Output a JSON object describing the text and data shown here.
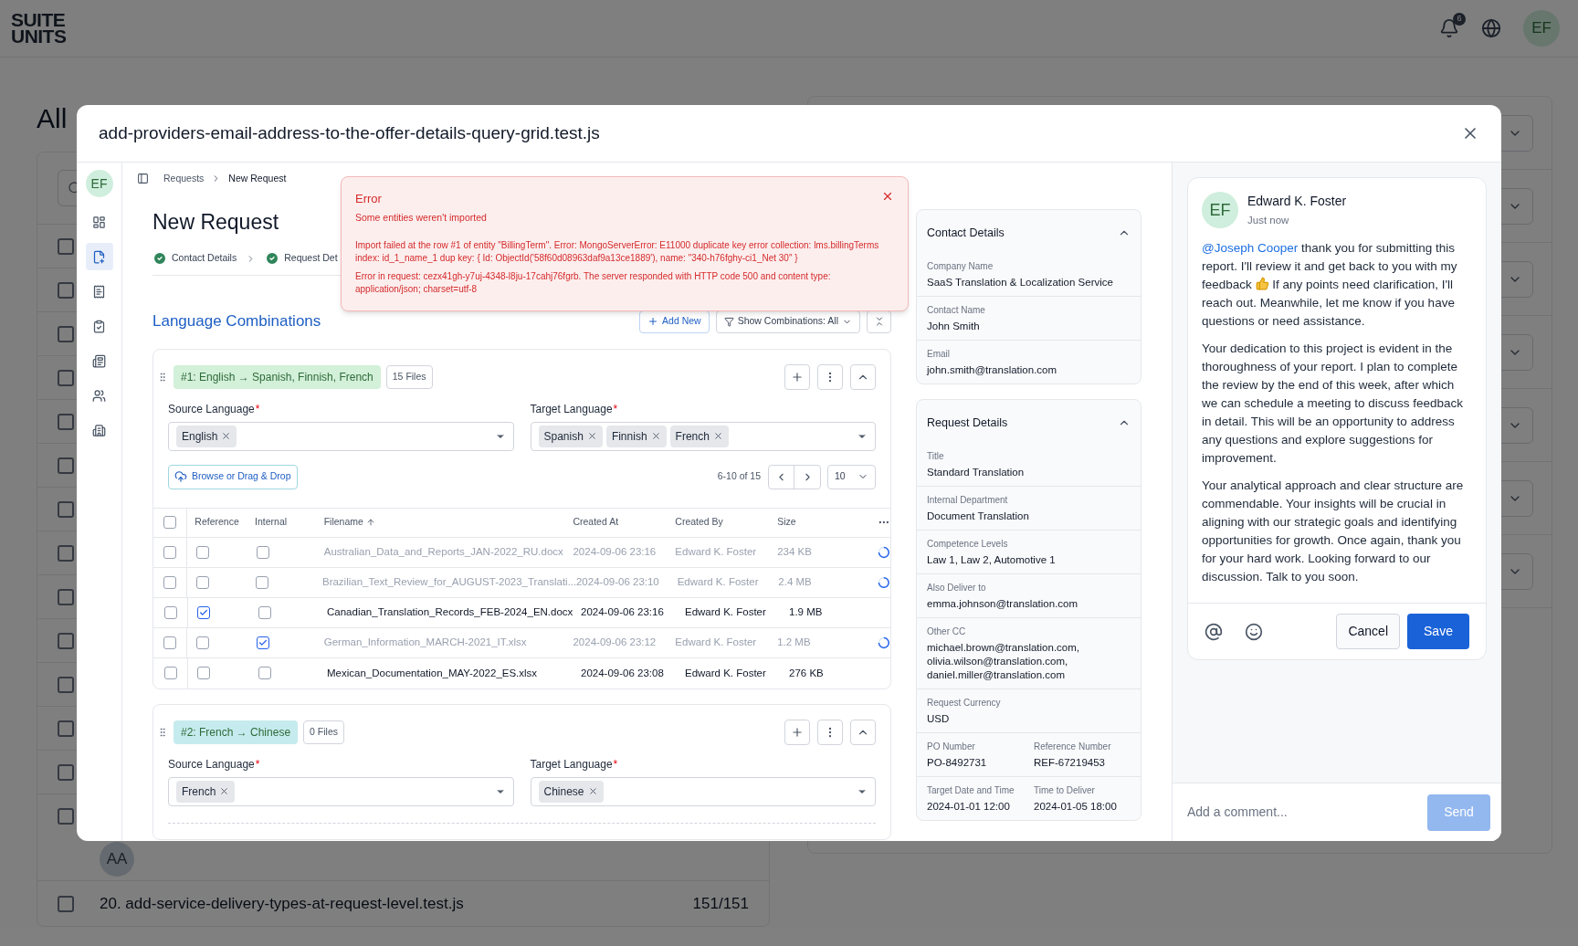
{
  "app": {
    "logo": [
      "SUITE",
      "UNITS"
    ],
    "notifications": "6",
    "avatar": "EF"
  },
  "background": {
    "title": "All",
    "avatar": "AA",
    "list_rows": [
      {
        "checked": false
      },
      {
        "checked": false
      },
      {
        "checked": false
      },
      {
        "checked": false
      },
      {
        "checked": false
      },
      {
        "checked": false
      },
      {
        "checked": false
      },
      {
        "checked": false
      },
      {
        "checked": false
      },
      {
        "checked": false
      },
      {
        "checked": false
      },
      {
        "checked": false
      },
      {
        "checked": false
      },
      {
        "checked": false
      }
    ],
    "rows": [
      {
        "checked": false,
        "text": "20. add-service-delivery-types-at-request-level.test.js",
        "count": "151/151"
      }
    ]
  },
  "modal": {
    "title": "add-providers-email-address-to-the-offer-details-query-grid.test.js"
  },
  "sidebar": {
    "avatar": "EF",
    "items": [
      {
        "selected": false
      },
      {
        "selected": true
      },
      {
        "selected": false
      },
      {
        "selected": false
      },
      {
        "selected": false
      },
      {
        "selected": false
      },
      {
        "selected": false
      }
    ]
  },
  "breadcrumb": [
    "Requests",
    "New Request"
  ],
  "page_title": "New Request",
  "steps": [
    {
      "label": "Contact Details",
      "done": true
    },
    {
      "label": "Request Det",
      "done": true
    }
  ],
  "error": {
    "title": "Error",
    "subtitle": "Some entities weren't imported",
    "messages": [
      "Import failed at the row #1 of entity \"BillingTerm\". Error: MongoServerError: E11000 duplicate key error collection: lms.billingTerms index: id_1_name_1 dup key: { Id: ObjectId('58f60d08963daf9a13ce1889'), name: \"340-h76fghy-ci1_Net 30\" }",
      "Error in request: cezx41gh-y7uj-4348-l8ju-17cahj76fgrb. The server responded with HTTP code 500 and content type: application/json; charset=utf-8"
    ]
  },
  "section_title": "Language Combinations",
  "actions": {
    "add": "Add New",
    "filter": "Show Combinations: All"
  },
  "combinations": [
    {
      "label": "#1: English → Spanish,  Finnish, French",
      "color": "#d3f0d9",
      "files": "15 Files",
      "required_mark": "*",
      "source_label": "Source Language",
      "target_label": "Target Language",
      "source": [
        "English"
      ],
      "target": [
        "Spanish",
        "Finnish",
        "French"
      ],
      "upload": "Browse or Drag & Drop",
      "pagination": "6-10 of 15",
      "page_size": "10",
      "table": {
        "columns": [
          {
            "label": "Reference",
            "sorted": false
          },
          {
            "label": "Internal",
            "sorted": false
          },
          {
            "label": "Filename",
            "sorted": true
          },
          {
            "label": "Created At",
            "sorted": false
          },
          {
            "label": "Created By",
            "sorted": false
          },
          {
            "label": "Size",
            "sorted": false
          }
        ],
        "all_selected": false,
        "rows": [
          {
            "selected": false,
            "reference": false,
            "internal": false,
            "filename": "Australian_Data_and_Reports_JAN-2022_RU.docx",
            "created_at": "2024-09-06 23:16",
            "created_by": "Edward K. Foster",
            "size": "234 KB",
            "processing": true
          },
          {
            "selected": false,
            "reference": false,
            "internal": false,
            "filename": "Brazilian_Text_Review_for_AUGUST-2023_Translati...",
            "created_at": "2024-09-06 23:10",
            "created_by": "Edward K. Foster",
            "size": "2.4 MB",
            "processing": true
          },
          {
            "selected": false,
            "reference": true,
            "internal": false,
            "filename": "Canadian_Translation_Records_FEB-2024_EN.docx",
            "created_at": "2024-09-06 23:16",
            "created_by": "Edward K. Foster",
            "size": "1.9 MB",
            "processing": false
          },
          {
            "selected": false,
            "reference": false,
            "internal": true,
            "filename": "German_Information_MARCH-2021_IT.xlsx",
            "created_at": "2024-09-06 23:12",
            "created_by": "Edward K. Foster",
            "size": "1.2 MB",
            "processing": true
          },
          {
            "selected": false,
            "reference": false,
            "internal": false,
            "filename": "Mexican_Documentation_MAY-2022_ES.xlsx",
            "created_at": "2024-09-06 23:08",
            "created_by": "Edward K. Foster",
            "size": "276 KB",
            "processing": false
          }
        ]
      }
    },
    {
      "label": "#2: French → Chinese",
      "color": "#c6ebee",
      "files": "0 Files",
      "required_mark": "*",
      "source_label": "Source Language",
      "target_label": "Target Language",
      "source": [
        "French"
      ],
      "target": [
        "Chinese"
      ]
    }
  ],
  "contact_details": {
    "title": "Contact Details",
    "expanded": true,
    "fields": [
      [
        {
          "label": "Company Name",
          "value": "SaaS Translation & Localization Service"
        }
      ],
      [
        {
          "label": "Contact Name",
          "value": "John Smith"
        }
      ],
      [
        {
          "label": "Email",
          "value": "john.smith@translation.com"
        }
      ]
    ]
  },
  "request_details": {
    "title": "Request Details",
    "expanded": true,
    "fields": [
      [
        {
          "label": "Title",
          "value": "Standard Translation"
        }
      ],
      [
        {
          "label": "Internal Department",
          "value": "Document Translation"
        }
      ],
      [
        {
          "label": "Competence Levels",
          "value": "Law 1, Law 2, Automotive 1"
        }
      ],
      [
        {
          "label": "Also Deliver to",
          "value": "emma.johnson@translation.com"
        }
      ],
      [
        {
          "label": "Other CC",
          "value": "michael.brown@translation.com, olivia.wilson@translation.com, daniel.miller@translation.com"
        }
      ],
      [
        {
          "label": "Request Currency",
          "value": "USD"
        }
      ],
      [
        {
          "label": "PO Number",
          "value": "PO-8492731"
        },
        {
          "label": "Reference Number",
          "value": "REF-67219453"
        }
      ],
      [
        {
          "label": "Target Date and Time",
          "value": "2024-01-01 12:00"
        },
        {
          "label": "Time to Deliver",
          "value": "2024-01-05 18:00"
        }
      ]
    ]
  },
  "comment": {
    "avatar": "EF",
    "author": "Edward K. Foster",
    "time": "Just now",
    "mention": "@Joseph Cooper",
    "text_before": "thank you for submitting this report. I'll review it and get back to you with my feedback",
    "text_after": "If any points need clarification, I'll reach out. Meanwhile, let me know if you have questions or need assistance.",
    "paragraphs": [
      "Your dedication to this project is evident in the thoroughness of your report. I plan to complete the review by the end of this week, after which we can schedule a meeting to discuss feedback in detail. This will be an opportunity to address any questions and explore suggestions for improvement.",
      "Your analytical approach and clear structure are commendable. Your insights will be crucial in aligning with our strategic goals and identifying opportunities for growth. Once again, thank you for your hard work. Looking forward to our discussion. Talk to you soon."
    ],
    "cancel": "Cancel",
    "save": "Save"
  },
  "composer": {
    "placeholder": "Add a comment...",
    "send": "Send",
    "send_disabled": true
  }
}
